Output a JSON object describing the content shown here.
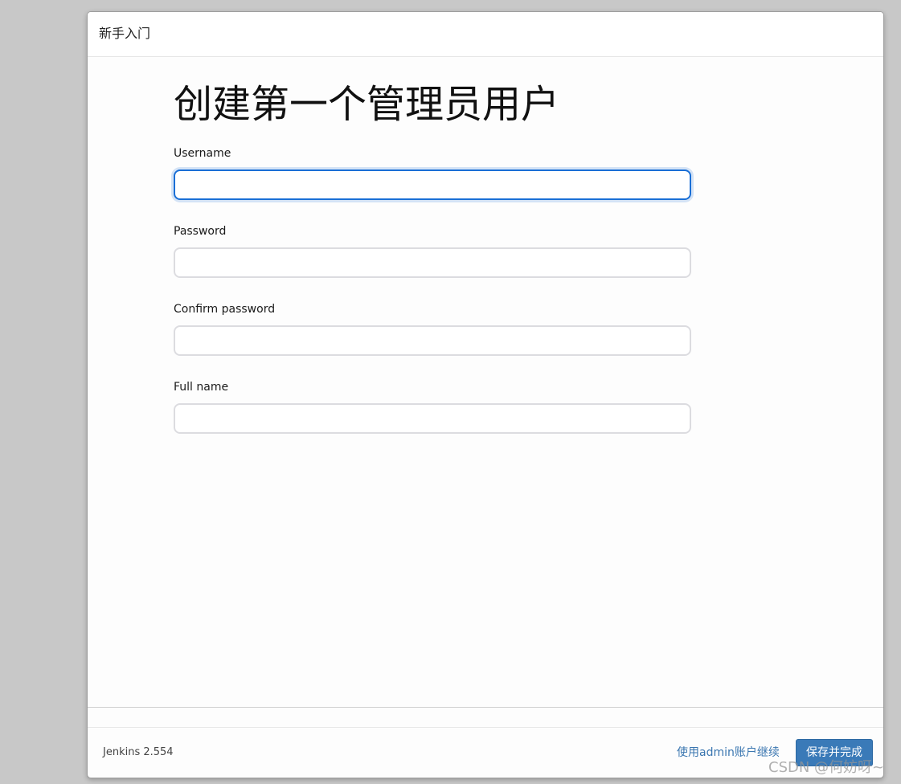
{
  "dialog": {
    "title": "新手入门"
  },
  "main": {
    "heading": "创建第一个管理员用户",
    "fields": [
      {
        "label": "Username",
        "value": "",
        "placeholder": ""
      },
      {
        "label": "Password",
        "value": "",
        "placeholder": ""
      },
      {
        "label": "Confirm password",
        "value": "",
        "placeholder": ""
      },
      {
        "label": "Full name",
        "value": "",
        "placeholder": ""
      }
    ]
  },
  "footer": {
    "version": "Jenkins 2.554",
    "skip_link": "使用admin账户继续",
    "save_button": "保存并完成"
  },
  "watermark": "CSDN @何妨呀~",
  "colors": {
    "primary_button": "#3a7ab8",
    "link": "#3a76b0",
    "focus_border": "#1a6fd6"
  }
}
